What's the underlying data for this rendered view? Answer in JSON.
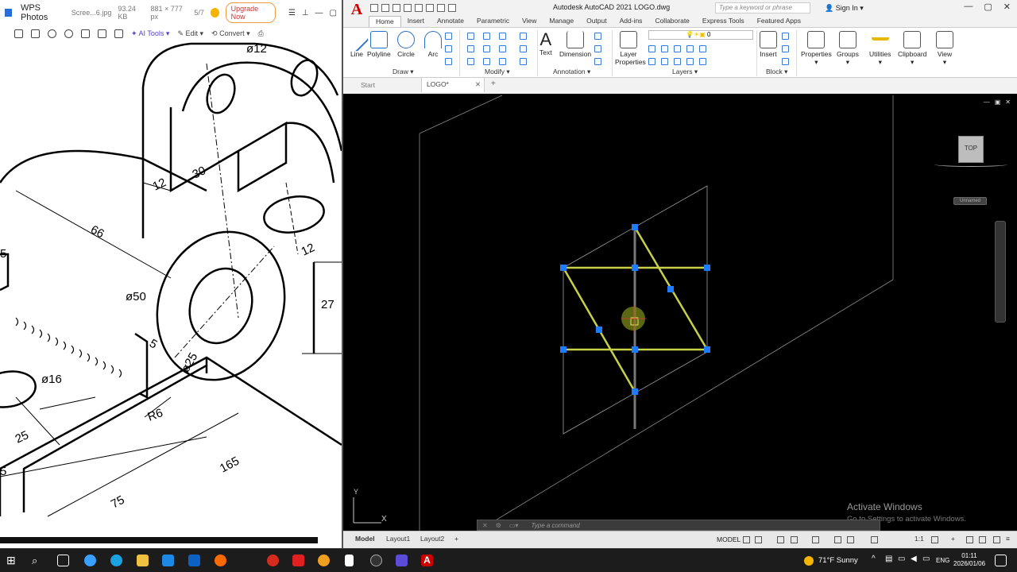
{
  "wps": {
    "app_name": "WPS Photos",
    "file_name": "Scree...6.jpg",
    "file_size": "93.24 KB",
    "dimensions": "881 × 777 px",
    "index": "5/7",
    "upgrade_label": "Upgrade Now",
    "toolbar": {
      "ai_tools": "AI Tools",
      "edit": "Edit",
      "convert": "Convert"
    },
    "drawing_labels": {
      "d12": "ø12",
      "d30": "30",
      "d12b": "12",
      "d66": "66",
      "d50": "ø50",
      "d5a": "5",
      "d27": "27",
      "d12c": "12",
      "d5b": "5",
      "d25d": "ø25",
      "d16": "ø16",
      "r6": "R6",
      "d25": "25",
      "d165": "165",
      "d75": "75",
      "d5c": "5"
    }
  },
  "acad": {
    "title": "Autodesk AutoCAD 2021   LOGO.dwg",
    "search_placeholder": "Type a keyword or phrase",
    "sign_in": "Sign In",
    "tabs": [
      "Home",
      "Insert",
      "Annotate",
      "Parametric",
      "View",
      "Manage",
      "Output",
      "Add-ins",
      "Collaborate",
      "Express Tools",
      "Featured Apps"
    ],
    "ribbon": {
      "draw": [
        "Line",
        "Polyline",
        "Circle",
        "Arc"
      ],
      "text": "Text",
      "dimension": "Dimension",
      "layer_properties": "Layer Properties",
      "layer_value": "0",
      "insert": "Insert",
      "properties": "Properties",
      "groups": "Groups",
      "utilities": "Utilities",
      "clipboard": "Clipboard",
      "view": "View",
      "groups_labels": {
        "draw": "Draw",
        "modify": "Modify",
        "annotation": "Annotation",
        "layers": "Layers",
        "block": "Block"
      }
    },
    "doc_tabs": {
      "start": "Start",
      "logo": "LOGO*"
    },
    "viewcube": "TOP",
    "named_view": "Unnamed",
    "ucs": {
      "y": "Y",
      "x": "X"
    },
    "command_placeholder": "Type  a  command",
    "layout_tabs": [
      "Model",
      "Layout1",
      "Layout2"
    ],
    "status_model": "MODEL",
    "status_scale": "1:1",
    "activate_title": "Activate Windows",
    "activate_sub": "Go to Settings to activate Windows."
  },
  "taskbar": {
    "weather": "71°F  Sunny",
    "lang": "ENG",
    "time": "01:11",
    "date": "2026/01/06"
  }
}
